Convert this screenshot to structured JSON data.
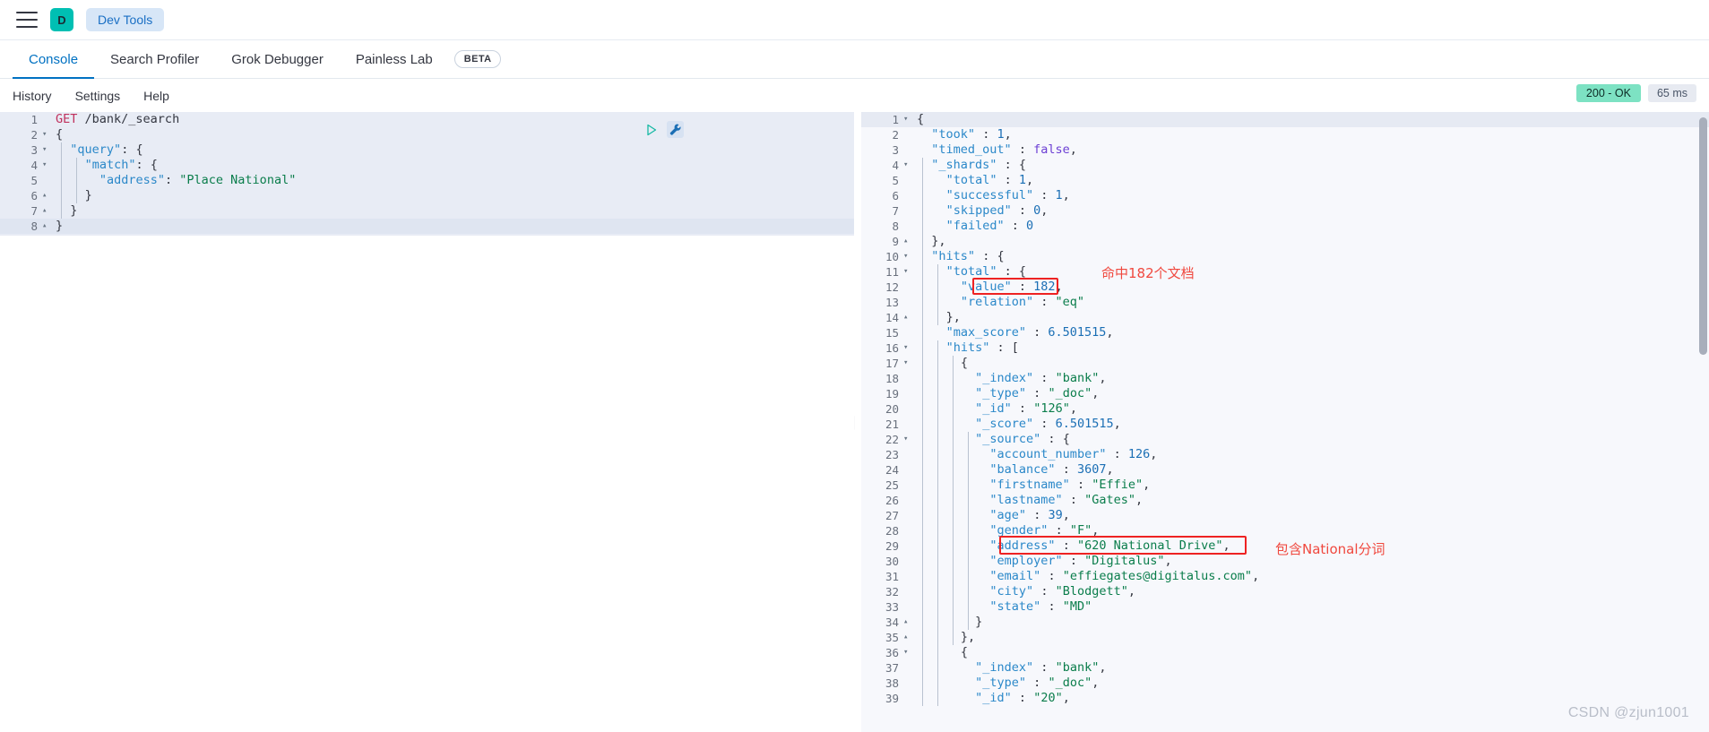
{
  "topbar": {
    "menu_icon": "hamburger-icon",
    "avatar_letter": "D",
    "app_pill": "Dev Tools"
  },
  "tabs": [
    {
      "label": "Console",
      "active": true
    },
    {
      "label": "Search Profiler",
      "active": false
    },
    {
      "label": "Grok Debugger",
      "active": false
    },
    {
      "label": "Painless Lab",
      "active": false
    }
  ],
  "beta_badge": "BETA",
  "submenu": [
    {
      "label": "History"
    },
    {
      "label": "Settings"
    },
    {
      "label": "Help"
    }
  ],
  "status": {
    "code": "200 - OK",
    "time": "65 ms",
    "ok_color": "#7de2c3"
  },
  "editor_actions": {
    "play": "play-icon",
    "wrench": "wrench-icon"
  },
  "request_editor": {
    "lines": [
      {
        "n": "1",
        "fold": "",
        "text": "GET /bank/_search",
        "kind": "request"
      },
      {
        "n": "2",
        "fold": "▾",
        "text": "{",
        "kind": "plain"
      },
      {
        "n": "3",
        "fold": "▾",
        "text": "  \"query\": {",
        "kind": "kv"
      },
      {
        "n": "4",
        "fold": "▾",
        "text": "    \"match\": {",
        "kind": "kv"
      },
      {
        "n": "5",
        "fold": "",
        "text": "      \"address\": \"Place National\"",
        "kind": "kvs"
      },
      {
        "n": "6",
        "fold": "▴",
        "text": "    }",
        "kind": "plain"
      },
      {
        "n": "7",
        "fold": "▴",
        "text": "  }",
        "kind": "plain"
      },
      {
        "n": "8",
        "fold": "▴",
        "text": "}",
        "kind": "plain"
      }
    ]
  },
  "response_editor": {
    "lines": [
      {
        "n": "1",
        "fold": "▾",
        "text": "{"
      },
      {
        "n": "2",
        "fold": "",
        "text": "  \"took\" : 1,"
      },
      {
        "n": "3",
        "fold": "",
        "text": "  \"timed_out\" : false,"
      },
      {
        "n": "4",
        "fold": "▾",
        "text": "  \"_shards\" : {"
      },
      {
        "n": "5",
        "fold": "",
        "text": "    \"total\" : 1,"
      },
      {
        "n": "6",
        "fold": "",
        "text": "    \"successful\" : 1,"
      },
      {
        "n": "7",
        "fold": "",
        "text": "    \"skipped\" : 0,"
      },
      {
        "n": "8",
        "fold": "",
        "text": "    \"failed\" : 0"
      },
      {
        "n": "9",
        "fold": "▴",
        "text": "  },"
      },
      {
        "n": "10",
        "fold": "▾",
        "text": "  \"hits\" : {"
      },
      {
        "n": "11",
        "fold": "▾",
        "text": "    \"total\" : {"
      },
      {
        "n": "12",
        "fold": "",
        "text": "      \"value\" : 182,"
      },
      {
        "n": "13",
        "fold": "",
        "text": "      \"relation\" : \"eq\""
      },
      {
        "n": "14",
        "fold": "▴",
        "text": "    },"
      },
      {
        "n": "15",
        "fold": "",
        "text": "    \"max_score\" : 6.501515,"
      },
      {
        "n": "16",
        "fold": "▾",
        "text": "    \"hits\" : ["
      },
      {
        "n": "17",
        "fold": "▾",
        "text": "      {"
      },
      {
        "n": "18",
        "fold": "",
        "text": "        \"_index\" : \"bank\","
      },
      {
        "n": "19",
        "fold": "",
        "text": "        \"_type\" : \"_doc\","
      },
      {
        "n": "20",
        "fold": "",
        "text": "        \"_id\" : \"126\","
      },
      {
        "n": "21",
        "fold": "",
        "text": "        \"_score\" : 6.501515,"
      },
      {
        "n": "22",
        "fold": "▾",
        "text": "        \"_source\" : {"
      },
      {
        "n": "23",
        "fold": "",
        "text": "          \"account_number\" : 126,"
      },
      {
        "n": "24",
        "fold": "",
        "text": "          \"balance\" : 3607,"
      },
      {
        "n": "25",
        "fold": "",
        "text": "          \"firstname\" : \"Effie\","
      },
      {
        "n": "26",
        "fold": "",
        "text": "          \"lastname\" : \"Gates\","
      },
      {
        "n": "27",
        "fold": "",
        "text": "          \"age\" : 39,"
      },
      {
        "n": "28",
        "fold": "",
        "text": "          \"gender\" : \"F\","
      },
      {
        "n": "29",
        "fold": "",
        "text": "          \"address\" : \"620 National Drive\","
      },
      {
        "n": "30",
        "fold": "",
        "text": "          \"employer\" : \"Digitalus\","
      },
      {
        "n": "31",
        "fold": "",
        "text": "          \"email\" : \"effiegates@digitalus.com\","
      },
      {
        "n": "32",
        "fold": "",
        "text": "          \"city\" : \"Blodgett\","
      },
      {
        "n": "33",
        "fold": "",
        "text": "          \"state\" : \"MD\""
      },
      {
        "n": "34",
        "fold": "▴",
        "text": "        }"
      },
      {
        "n": "35",
        "fold": "▴",
        "text": "      },"
      },
      {
        "n": "36",
        "fold": "▾",
        "text": "      {"
      },
      {
        "n": "37",
        "fold": "",
        "text": "        \"_index\" : \"bank\","
      },
      {
        "n": "38",
        "fold": "",
        "text": "        \"_type\" : \"_doc\","
      },
      {
        "n": "39",
        "fold": "",
        "text": "        \"_id\" : \"20\","
      }
    ]
  },
  "annotations": [
    {
      "id": "hits-total",
      "text": "命中182个文档"
    },
    {
      "id": "address-token",
      "text": "包含National分词"
    }
  ],
  "watermark": "CSDN @zjun1001"
}
